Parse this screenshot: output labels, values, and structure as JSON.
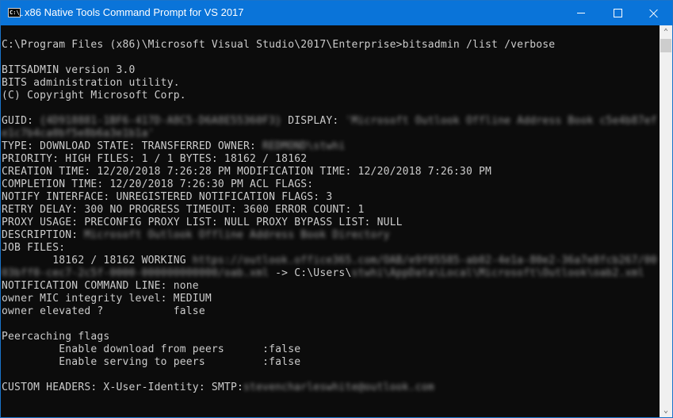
{
  "window": {
    "title": "x86 Native Tools Command Prompt for VS 2017",
    "icon": "cmd-icon",
    "icon_text": "C:\\_",
    "controls": {
      "minimize": "minimize-icon",
      "maximize": "maximize-icon",
      "close": "close-icon"
    }
  },
  "console": {
    "lines": [
      {
        "text": "C:\\Program Files (x86)\\Microsoft Visual Studio\\2017\\Enterprise>bitsadmin /list /verbose"
      },
      {
        "text": ""
      },
      {
        "text": "BITSADMIN version 3.0"
      },
      {
        "text": "BITS administration utility."
      },
      {
        "text": "(C) Copyright Microsoft Corp."
      },
      {
        "text": ""
      },
      {
        "text": "GUID: ",
        "redacted": "{4D918881-1BF6-417D-A8C5-D6A8E55360F3}",
        "after": " DISPLAY: ",
        "redacted2": "'Microsoft Outlook Offline Address Book c5e4b87ef"
      },
      {
        "redacted": "e1c7b4ca0bf5e8b6a3e1b1a'"
      },
      {
        "text": "TYPE: DOWNLOAD STATE: TRANSFERRED OWNER: ",
        "redacted": "REDMOND\\stwhi"
      },
      {
        "text": "PRIORITY: HIGH FILES: 1 / 1 BYTES: 18162 / 18162"
      },
      {
        "text": "CREATION TIME: 12/20/2018 7:26:28 PM MODIFICATION TIME: 12/20/2018 7:26:30 PM"
      },
      {
        "text": "COMPLETION TIME: 12/20/2018 7:26:30 PM ACL FLAGS:"
      },
      {
        "text": "NOTIFY INTERFACE: UNREGISTERED NOTIFICATION FLAGS: 3"
      },
      {
        "text": "RETRY DELAY: 300 NO PROGRESS TIMEOUT: 3600 ERROR COUNT: 1"
      },
      {
        "text": "PROXY USAGE: PRECONFIG PROXY LIST: NULL PROXY BYPASS LIST: NULL"
      },
      {
        "text": "DESCRIPTION: ",
        "redacted": "Microsoft Outlook Offline Address Book Directory"
      },
      {
        "text": "JOB FILES:"
      },
      {
        "text": "        18162 / 18162 WORKING ",
        "redacted": "https://outlook.office365.com/OAB/e9f05585-ab02-4e1a-80e2-36a7e8fcb267/00"
      },
      {
        "redacted": "03bff0-cec7-2c5f-0000-000000000000/oab.xml",
        "after": " -> C:\\Users\\",
        "redacted2": "stwhi\\AppData\\Local\\Microsoft\\Outlook\\oab2.xml"
      },
      {
        "text": "NOTIFICATION COMMAND LINE: none"
      },
      {
        "text": "owner MIC integrity level: MEDIUM"
      },
      {
        "text": "owner elevated ?           false"
      },
      {
        "text": ""
      },
      {
        "text": "Peercaching flags"
      },
      {
        "text": "         Enable download from peers      :false"
      },
      {
        "text": "         Enable serving to peers         :false"
      },
      {
        "text": ""
      },
      {
        "text": "CUSTOM HEADERS: X-User-Identity: SMTP:",
        "redacted": "stevencharleswhite@outlook.com"
      }
    ]
  },
  "scrollbar": {
    "up": "chevron-up-icon",
    "down": "chevron-down-icon",
    "up_glyph": "⌃",
    "down_glyph": "⌄"
  }
}
